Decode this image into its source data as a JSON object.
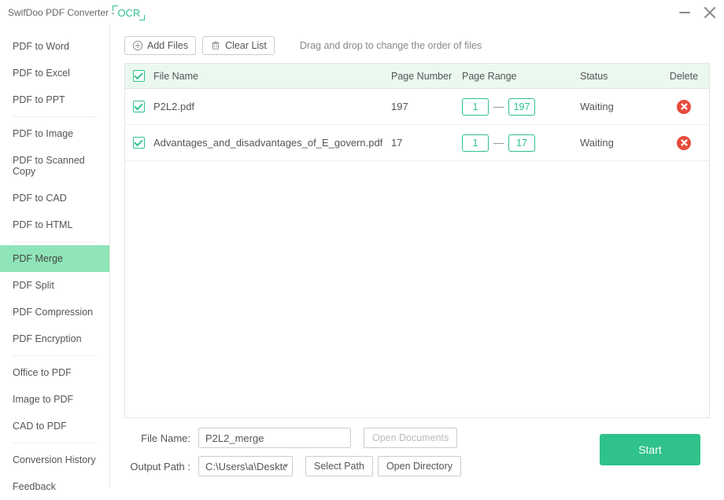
{
  "titlebar": {
    "title": "SwifDoo PDF Converter - ",
    "ocr_label": "OCR"
  },
  "sidebar": {
    "groups": [
      [
        "PDF to Word",
        "PDF to Excel",
        "PDF to PPT"
      ],
      [
        "PDF to Image",
        "PDF to Scanned Copy",
        "PDF to CAD",
        "PDF to HTML"
      ],
      [
        "PDF Merge",
        "PDF Split",
        "PDF Compression",
        "PDF Encryption"
      ],
      [
        "Office to PDF",
        "Image to PDF",
        "CAD to PDF"
      ],
      [
        "Conversion History",
        "Feedback"
      ]
    ],
    "active": "PDF Merge"
  },
  "toolbar": {
    "add_files": "Add Files",
    "clear_list": "Clear List",
    "drag_hint": "Drag and drop to change the order of files"
  },
  "table": {
    "headers": {
      "file_name": "File Name",
      "page_number": "Page Number",
      "page_range": "Page Range",
      "status": "Status",
      "delete": "Delete"
    },
    "rows": [
      {
        "checked": true,
        "name": "P2L2.pdf",
        "pages": "197",
        "range_from": "1",
        "range_to": "197",
        "status": "Waiting"
      },
      {
        "checked": true,
        "name": "Advantages_and_disadvantages_of_E_govern.pdf",
        "pages": "17",
        "range_from": "1",
        "range_to": "17",
        "status": "Waiting"
      }
    ]
  },
  "bottom": {
    "file_name_label": "File Name:",
    "file_name_value": "P2L2_merge",
    "open_documents": "Open Documents",
    "output_path_label": "Output Path :",
    "output_path_value": "C:\\Users\\a\\Desktop",
    "select_path": "Select Path",
    "open_directory": "Open Directory",
    "start": "Start"
  }
}
